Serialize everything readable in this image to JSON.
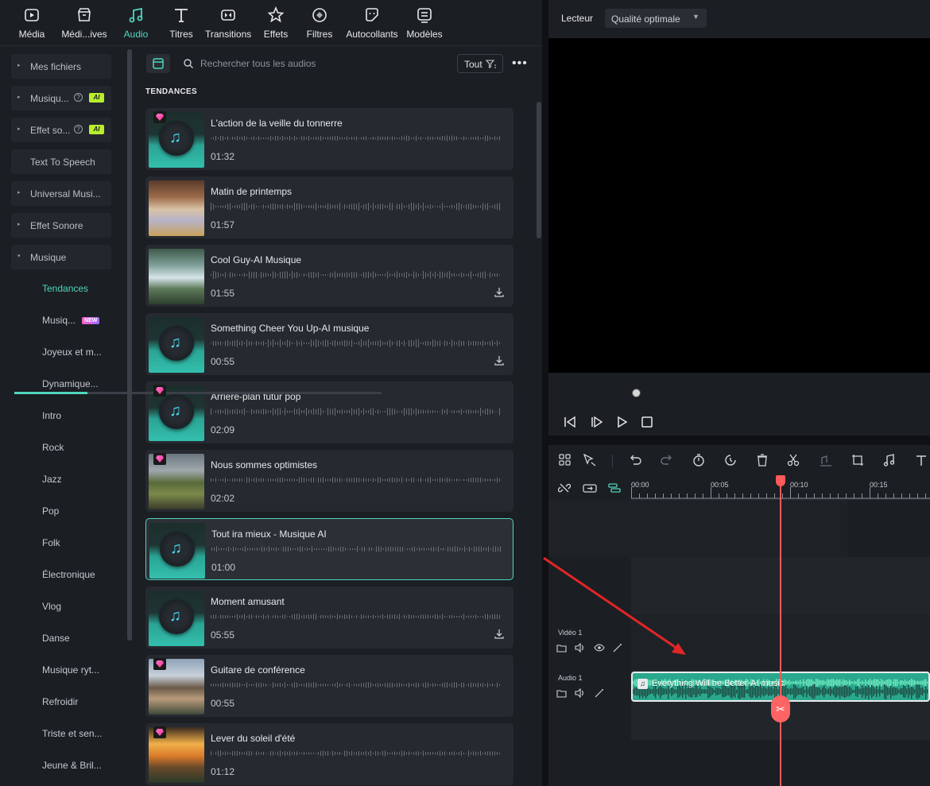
{
  "top_tabs": [
    {
      "label": "Média",
      "icon": "media-icon"
    },
    {
      "label": "Médi...ives",
      "icon": "stock-media-icon"
    },
    {
      "label": "Audio",
      "icon": "music-note-icon",
      "active": true
    },
    {
      "label": "Titres",
      "icon": "text-t-icon"
    },
    {
      "label": "Transitions",
      "icon": "transition-icon"
    },
    {
      "label": "Effets",
      "icon": "effects-star-icon"
    },
    {
      "label": "Filtres",
      "icon": "filter-icon"
    },
    {
      "label": "Autocollants",
      "icon": "sticker-icon"
    },
    {
      "label": "Modèles",
      "icon": "template-icon"
    }
  ],
  "sidebar": {
    "groups": [
      {
        "label": "Mes fichiers",
        "arrow": "▸"
      },
      {
        "label": "Musiqu...",
        "arrow": "▸",
        "help": "?",
        "ai": "AI"
      },
      {
        "label": "Effet so...",
        "arrow": "▸",
        "help": "?",
        "ai": "AI"
      },
      {
        "label": "Text To Speech"
      },
      {
        "label": "Universal Musi...",
        "arrow": "▸"
      },
      {
        "label": "Effet Sonore",
        "arrow": "▸"
      },
      {
        "label": "Musique",
        "arrow": "▾"
      }
    ],
    "subitems": [
      {
        "label": "Tendances",
        "active": true
      },
      {
        "label": "Musiq...",
        "badge": "NEW"
      },
      {
        "label": "Joyeux et m..."
      },
      {
        "label": "Dynamique..."
      },
      {
        "label": "Intro"
      },
      {
        "label": "Rock"
      },
      {
        "label": "Jazz"
      },
      {
        "label": "Pop"
      },
      {
        "label": "Folk"
      },
      {
        "label": "Électronique"
      },
      {
        "label": "Vlog"
      },
      {
        "label": "Danse"
      },
      {
        "label": "Musique ryt..."
      },
      {
        "label": "Refroidir"
      },
      {
        "label": "Triste et sen..."
      },
      {
        "label": "Jeune & Bril..."
      }
    ]
  },
  "search": {
    "placeholder": "Rechercher tous les audios",
    "filter_label": "Tout",
    "more": "•••"
  },
  "section_title": "TENDANCES",
  "tracks": [
    {
      "title": "L'action de la veille du tonnerre",
      "duration": "01:32",
      "thumb": "music",
      "premium": true,
      "download": false
    },
    {
      "title": "Matin de printemps",
      "duration": "01:57",
      "thumb": "landscape-lake",
      "premium": false,
      "download": false
    },
    {
      "title": "Cool Guy-AI Musique",
      "duration": "01:55",
      "thumb": "landscape-stream",
      "premium": false,
      "download": true
    },
    {
      "title": "Something Cheer You Up-AI musique",
      "duration": "00:55",
      "thumb": "music",
      "premium": false,
      "download": true
    },
    {
      "title": "Arrière-plan futur pop",
      "duration": "02:09",
      "thumb": "music",
      "premium": true,
      "download": false
    },
    {
      "title": "Nous sommes optimistes",
      "duration": "02:02",
      "thumb": "landscape-hills",
      "premium": true,
      "download": false
    },
    {
      "title": "Tout ira mieux - Musique AI",
      "duration": "01:00",
      "thumb": "music",
      "premium": false,
      "download": false,
      "selected": true
    },
    {
      "title": "Moment amusant",
      "duration": "05:55",
      "thumb": "music",
      "premium": false,
      "download": true
    },
    {
      "title": "Guitare de conférence",
      "duration": "00:55",
      "thumb": "landscape-river",
      "premium": true,
      "download": false
    },
    {
      "title": "Lever du soleil d'été",
      "duration": "01:12",
      "thumb": "landscape-sunset",
      "premium": true,
      "download": false
    }
  ],
  "player": {
    "label": "Lecteur",
    "quality": "Qualité optimale",
    "progress": 0.2
  },
  "timeline": {
    "ruler": [
      "00:00",
      "00:05",
      "00:10",
      "00:15"
    ],
    "tracks": [
      {
        "name": "Vidéo 1"
      },
      {
        "name": "Audio 1"
      }
    ],
    "clip_name": "Everything Will be Better-AI music"
  },
  "colors": {
    "accent": "#4fd6bd",
    "playhead": "#ff5a5a",
    "clip": "#2aa88e",
    "arrow": "#e02626"
  }
}
